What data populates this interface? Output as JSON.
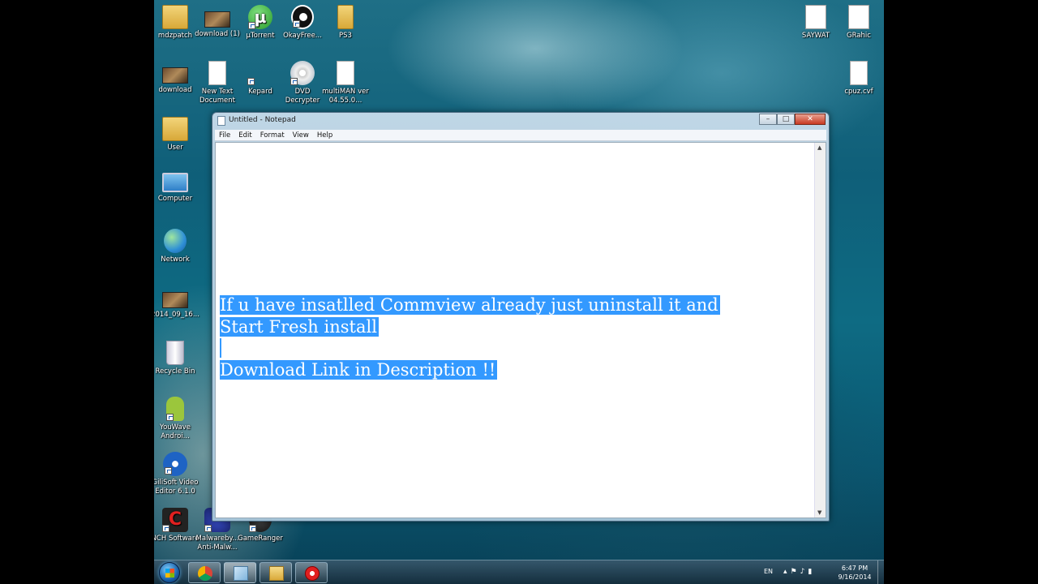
{
  "desktop": {
    "icons": [
      {
        "label": "mdzpatch",
        "icon": "folder-icon"
      },
      {
        "label": "download (1)",
        "icon": "image-thumbnail-icon"
      },
      {
        "label": "µTorrent",
        "icon": "utorrent-icon"
      },
      {
        "label": "OkayFree...",
        "icon": "eye-app-icon"
      },
      {
        "label": "PS3",
        "icon": "folder-icon"
      },
      {
        "label": "download",
        "icon": "image-thumbnail-icon"
      },
      {
        "label": "New Text Document",
        "icon": "text-document-icon"
      },
      {
        "label": "Kepard",
        "icon": "app-shortcut-icon"
      },
      {
        "label": "DVD Decrypter",
        "icon": "dvd-disc-icon"
      },
      {
        "label": "multiMAN ver 04.55.0...",
        "icon": "document-icon"
      },
      {
        "label": "User",
        "icon": "user-folder-icon"
      },
      {
        "label": "Computer",
        "icon": "computer-icon"
      },
      {
        "label": "Network",
        "icon": "network-globe-icon"
      },
      {
        "label": "2014_09_16...",
        "icon": "video-thumbnail-icon"
      },
      {
        "label": "Recycle Bin",
        "icon": "recycle-bin-icon"
      },
      {
        "label": "YouWave Androi...",
        "icon": "android-icon"
      },
      {
        "label": "GiliSoft Video Editor 6.1.0",
        "icon": "film-reel-icon"
      },
      {
        "label": "NCH Software",
        "icon": "nch-icon"
      },
      {
        "label": "Malwareby... Anti-Malw...",
        "icon": "malwarebytes-icon"
      },
      {
        "label": "GameRanger",
        "icon": "gameranger-icon"
      },
      {
        "label": "SAYWAT",
        "icon": "paper-icon"
      },
      {
        "label": "GRahic",
        "icon": "paper-icon"
      },
      {
        "label": "cpuz.cvf",
        "icon": "document-icon"
      }
    ]
  },
  "notepad": {
    "title": "Untitled - Notepad",
    "menus": [
      "File",
      "Edit",
      "Format",
      "View",
      "Help"
    ],
    "content_lines": [
      "If u have insatlled Commview already just uninstall it and",
      "Start Fresh install ",
      "",
      "Download Link in Description !!"
    ],
    "selection_color": "#3399ff"
  },
  "taskbar": {
    "pinned": [
      "chrome-icon",
      "window-switcher-icon",
      "explorer-icon",
      "recorder-icon"
    ],
    "language": "EN",
    "time": "6:47 PM",
    "date": "9/16/2014"
  }
}
